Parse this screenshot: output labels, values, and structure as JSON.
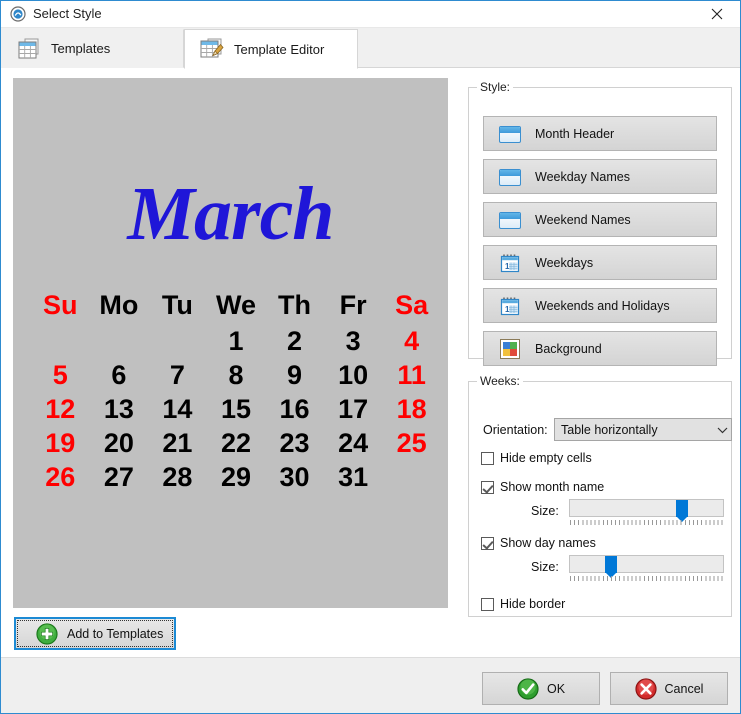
{
  "window": {
    "title": "Select Style",
    "title_icon": "app-disc-icon",
    "close_icon": "close-icon",
    "border_color": "#2e8bd0"
  },
  "tabs": [
    {
      "label": "Templates",
      "icon": "table-grid-icon",
      "active": false
    },
    {
      "label": "Template Editor",
      "icon": "table-grid-brush-icon",
      "active": true
    }
  ],
  "preview": {
    "background_color": "#c0c0c0",
    "month_name": "March",
    "month_color": "#1f16d8",
    "weekend_color": "#ff0000",
    "weekday_color": "#000000",
    "day_names": [
      "Su",
      "Mo",
      "Tu",
      "We",
      "Th",
      "Fr",
      "Sa"
    ],
    "weekend_columns": [
      0,
      6
    ],
    "weeks": [
      [
        "",
        "",
        "",
        "1",
        "2",
        "3",
        "4"
      ],
      [
        "5",
        "6",
        "7",
        "8",
        "9",
        "10",
        "11"
      ],
      [
        "12",
        "13",
        "14",
        "15",
        "16",
        "17",
        "18"
      ],
      [
        "19",
        "20",
        "21",
        "22",
        "23",
        "24",
        "25"
      ],
      [
        "26",
        "27",
        "28",
        "29",
        "30",
        "31",
        ""
      ]
    ]
  },
  "style_group": {
    "legend": "Style:",
    "buttons": [
      {
        "label": "Month Header",
        "icon": "window-panel-icon"
      },
      {
        "label": "Weekday Names",
        "icon": "window-panel-icon"
      },
      {
        "label": "Weekend Names",
        "icon": "window-panel-icon"
      },
      {
        "label": "Weekdays",
        "icon": "calendar-icon"
      },
      {
        "label": "Weekends and Holidays",
        "icon": "calendar-icon"
      },
      {
        "label": "Background",
        "icon": "color-palette-icon"
      }
    ]
  },
  "weeks_group": {
    "legend": "Weeks:",
    "orientation_label": "Orientation:",
    "orientation_value": "Table horizontally",
    "orientation_chevron": "chevron-down-icon",
    "hide_empty_cells": {
      "label": "Hide empty cells",
      "checked": false
    },
    "show_month_name": {
      "label": "Show month name",
      "checked": true
    },
    "month_size_label": "Size:",
    "month_size_percent": 73,
    "show_day_names": {
      "label": "Show day names",
      "checked": true
    },
    "day_size_label": "Size:",
    "day_size_percent": 27,
    "hide_border": {
      "label": "Hide border",
      "checked": false
    }
  },
  "add_to_templates": {
    "label": "Add to Templates",
    "icon": "green-plus-icon",
    "focused": true
  },
  "footer": {
    "ok_label": "OK",
    "ok_icon": "green-check-circle-icon",
    "cancel_label": "Cancel",
    "cancel_icon": "red-x-circle-icon"
  }
}
